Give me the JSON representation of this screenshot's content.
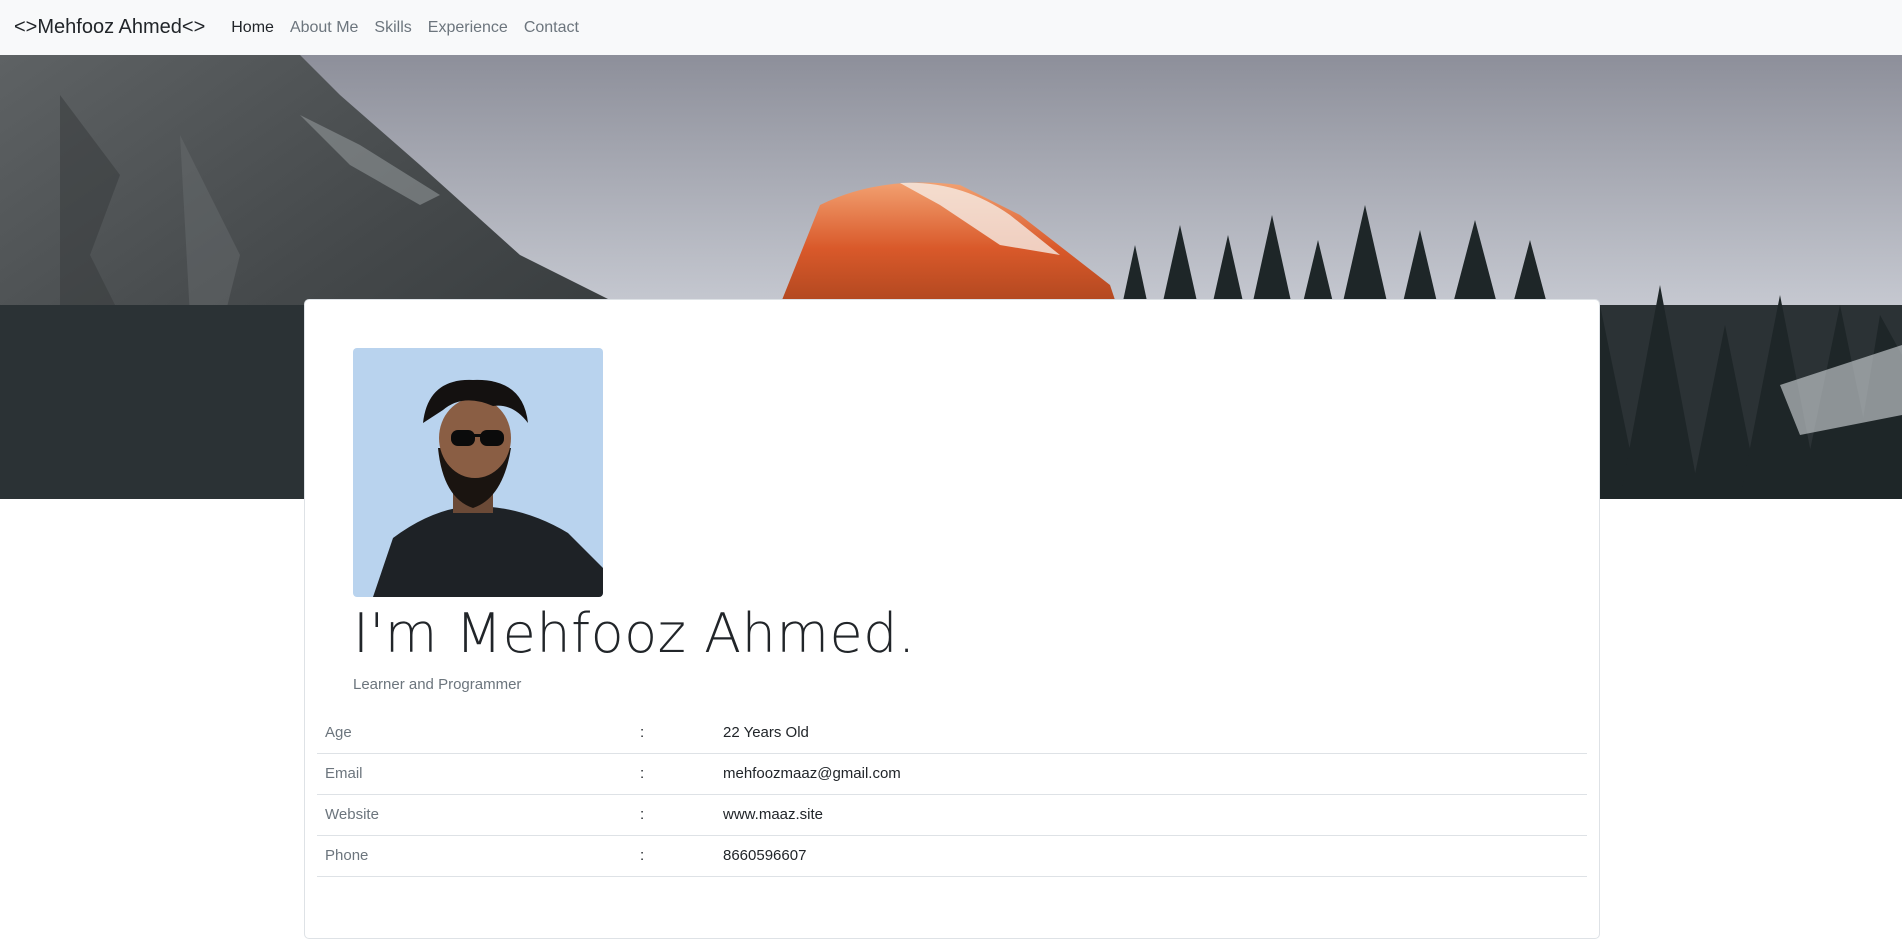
{
  "navbar": {
    "brand": "<>Mehfooz Ahmed<>",
    "links": [
      {
        "label": "Home"
      },
      {
        "label": "About Me"
      },
      {
        "label": "Skills"
      },
      {
        "label": "Experience"
      },
      {
        "label": "Contact"
      }
    ]
  },
  "hero": {
    "image": "mountain-landscape-banner"
  },
  "profile": {
    "photo": "profile-photo",
    "headline": "I'm Mehfooz Ahmed.",
    "tagline": "Learner and Programmer",
    "details": [
      {
        "label": "Age",
        "separator": ":",
        "value": "22 Years Old"
      },
      {
        "label": "Email",
        "separator": ":",
        "value": "mehfoozmaaz@gmail.com"
      },
      {
        "label": "Website",
        "separator": ":",
        "value": "www.maaz.site"
      },
      {
        "label": "Phone",
        "separator": ":",
        "value": "8660596607"
      }
    ]
  },
  "colors": {
    "navbar_bg": "#f8f9fa",
    "text_primary": "#212529",
    "text_muted": "#6c757d",
    "border": "#dee2e6"
  }
}
